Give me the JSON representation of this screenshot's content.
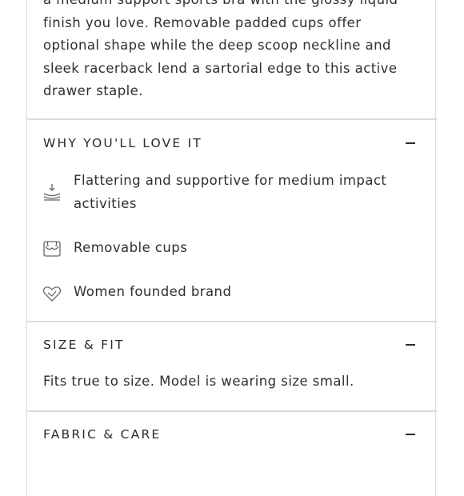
{
  "description": "a medium support sports bra with the glossy liquid finish you love. Removable padded cups offer optional shape while the deep scoop neckline and sleek racerback lend a sartorial edge to this active drawer staple.",
  "why_love": {
    "title": "WHY YOU'LL LOVE IT",
    "features": [
      {
        "icon": "impact-level-icon",
        "text": "Flattering and supportive for medium impact activities"
      },
      {
        "icon": "bra-cups-icon",
        "text": "Removable cups"
      },
      {
        "icon": "heart-hands-icon",
        "text": "Women founded brand"
      }
    ]
  },
  "size_fit": {
    "title": "SIZE & FIT",
    "text": "Fits true to size. Model is wearing size small."
  },
  "fabric_care": {
    "title": "FABRIC & CARE"
  }
}
